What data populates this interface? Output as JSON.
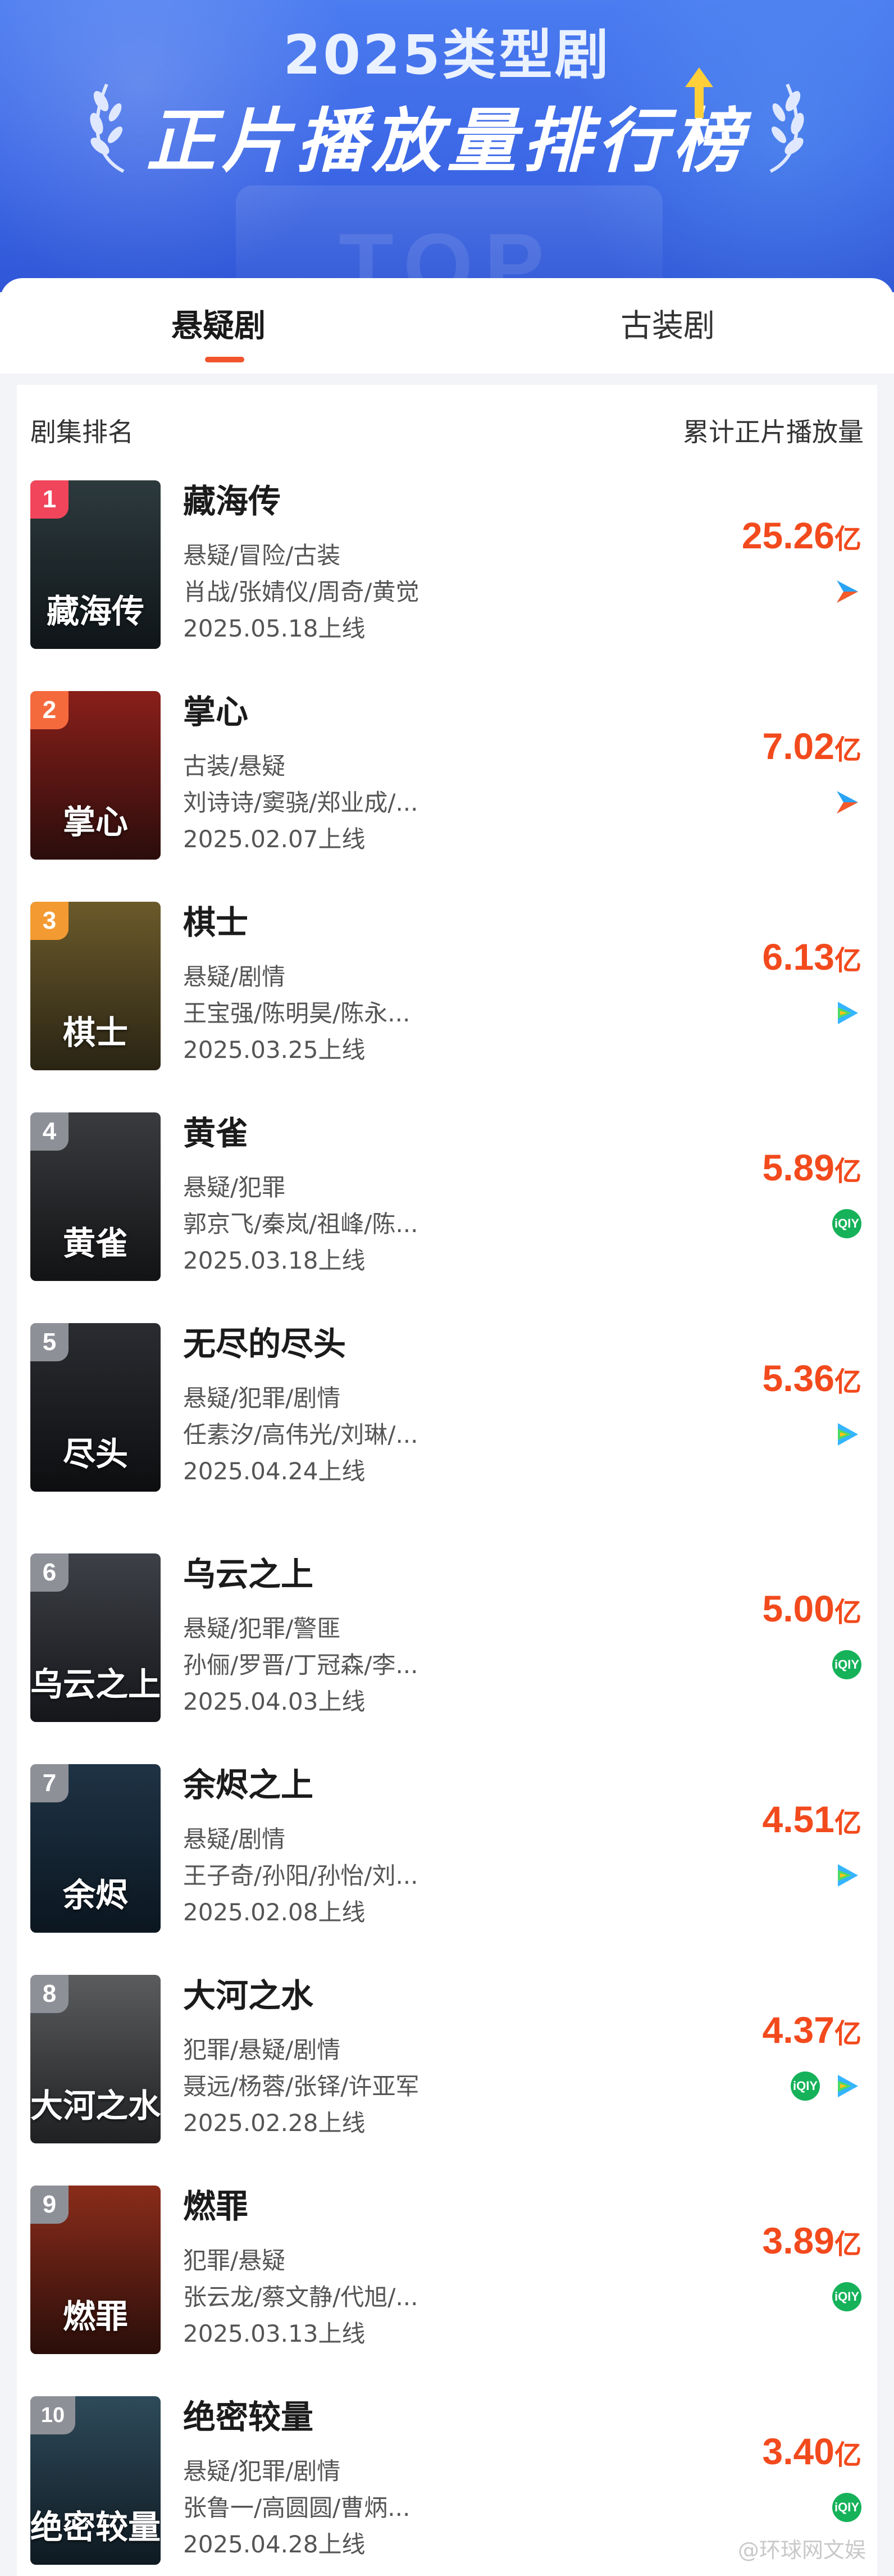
{
  "header": {
    "year_title": "2025类型剧",
    "main_title": "正片播放量排行榜",
    "bg_word": "TOP"
  },
  "tabs": [
    {
      "label": "悬疑剧",
      "active": true
    },
    {
      "label": "古装剧",
      "active": false
    }
  ],
  "list_header": {
    "left": "剧集排名",
    "right": "累计正片播放量"
  },
  "rows": [
    {
      "rank": "1",
      "title": "藏海传",
      "genre": "悬疑/冒险/古装",
      "cast": "肖战/张婧仪/周奇/黄觉",
      "date": "2025.05.18上线",
      "plays": "25.26",
      "unit": "亿",
      "poster_text": "藏海传",
      "platforms": [
        "youku-icon"
      ],
      "rank_color": "#f0455a",
      "poster_colors": [
        "#2d3a3d",
        "#0f1518"
      ]
    },
    {
      "rank": "2",
      "title": "掌心",
      "genre": "古装/悬疑",
      "cast": "刘诗诗/窦骁/郑业成/...",
      "date": "2025.02.07上线",
      "plays": "7.02",
      "unit": "亿",
      "poster_text": "掌心",
      "platforms": [
        "youku-icon"
      ],
      "rank_color": "#f56a3d",
      "poster_colors": [
        "#8a1f1a",
        "#2a0d0c"
      ]
    },
    {
      "rank": "3",
      "title": "棋士",
      "genre": "悬疑/剧情",
      "cast": "王宝强/陈明昊/陈永...",
      "date": "2025.03.25上线",
      "plays": "6.13",
      "unit": "亿",
      "poster_text": "棋士",
      "platforms": [
        "tencent-video-icon"
      ],
      "rank_color": "#f39a32",
      "poster_colors": [
        "#6b5a2a",
        "#2a2414"
      ]
    },
    {
      "rank": "4",
      "title": "黄雀",
      "genre": "悬疑/犯罪",
      "cast": "郭京飞/秦岚/祖峰/陈...",
      "date": "2025.03.18上线",
      "plays": "5.89",
      "unit": "亿",
      "poster_text": "黄雀",
      "platforms": [
        "iqiyi-icon"
      ],
      "rank_color": "#8e9098",
      "poster_colors": [
        "#3a3b3e",
        "#121315"
      ]
    },
    {
      "rank": "5",
      "title": "无尽的尽头",
      "genre": "悬疑/犯罪/剧情",
      "cast": "任素汐/高伟光/刘琳/...",
      "date": "2025.04.24上线",
      "plays": "5.36",
      "unit": "亿",
      "poster_text": "尽头",
      "platforms": [
        "tencent-video-icon"
      ],
      "rank_color": "#8e9098",
      "poster_colors": [
        "#2a2c31",
        "#0d0e10"
      ]
    },
    {
      "rank": "6",
      "title": "乌云之上",
      "genre": "悬疑/犯罪/警匪",
      "cast": "孙俪/罗晋/丁冠森/李...",
      "date": "2025.04.03上线",
      "plays": "5.00",
      "unit": "亿",
      "poster_text": "乌云之上",
      "platforms": [
        "iqiyi-icon"
      ],
      "rank_color": "#8e9098",
      "poster_colors": [
        "#3d4046",
        "#15161a"
      ]
    },
    {
      "rank": "7",
      "title": "余烬之上",
      "genre": "悬疑/剧情",
      "cast": "王子奇/孙阳/孙怡/刘...",
      "date": "2025.02.08上线",
      "plays": "4.51",
      "unit": "亿",
      "poster_text": "余烬",
      "platforms": [
        "tencent-video-icon"
      ],
      "rank_color": "#8e9098",
      "poster_colors": [
        "#1f3345",
        "#0b1620"
      ]
    },
    {
      "rank": "8",
      "title": "大河之水",
      "genre": "犯罪/悬疑/剧情",
      "cast": "聂远/杨蓉/张铎/许亚军",
      "date": "2025.02.28上线",
      "plays": "4.37",
      "unit": "亿",
      "poster_text": "大河之水",
      "platforms": [
        "iqiyi-icon",
        "tencent-video-icon"
      ],
      "rank_color": "#8e9098",
      "poster_colors": [
        "#5a5c5e",
        "#1e2022"
      ]
    },
    {
      "rank": "9",
      "title": "燃罪",
      "genre": "犯罪/悬疑",
      "cast": "张云龙/蔡文静/代旭/...",
      "date": "2025.03.13上线",
      "plays": "3.89",
      "unit": "亿",
      "poster_text": "燃罪",
      "platforms": [
        "iqiyi-icon"
      ],
      "rank_color": "#8e9098",
      "poster_colors": [
        "#8a2c1a",
        "#2a0e0a"
      ]
    },
    {
      "rank": "10",
      "title": "绝密较量",
      "genre": "悬疑/犯罪/剧情",
      "cast": "张鲁一/高圆圆/曹炳...",
      "date": "2025.04.28上线",
      "plays": "3.40",
      "unit": "亿",
      "poster_text": "绝密较量",
      "platforms": [
        "iqiyi-icon"
      ],
      "rank_color": "#8e9098",
      "poster_colors": [
        "#2e4a5a",
        "#0f1a22"
      ]
    }
  ],
  "watermark": "@环球网文娱",
  "icons": {
    "youku": "youku-icon",
    "tencent": "tencent-video-icon",
    "iqiyi": "iqiyi-icon"
  },
  "iqiyi_text": "iQIY"
}
